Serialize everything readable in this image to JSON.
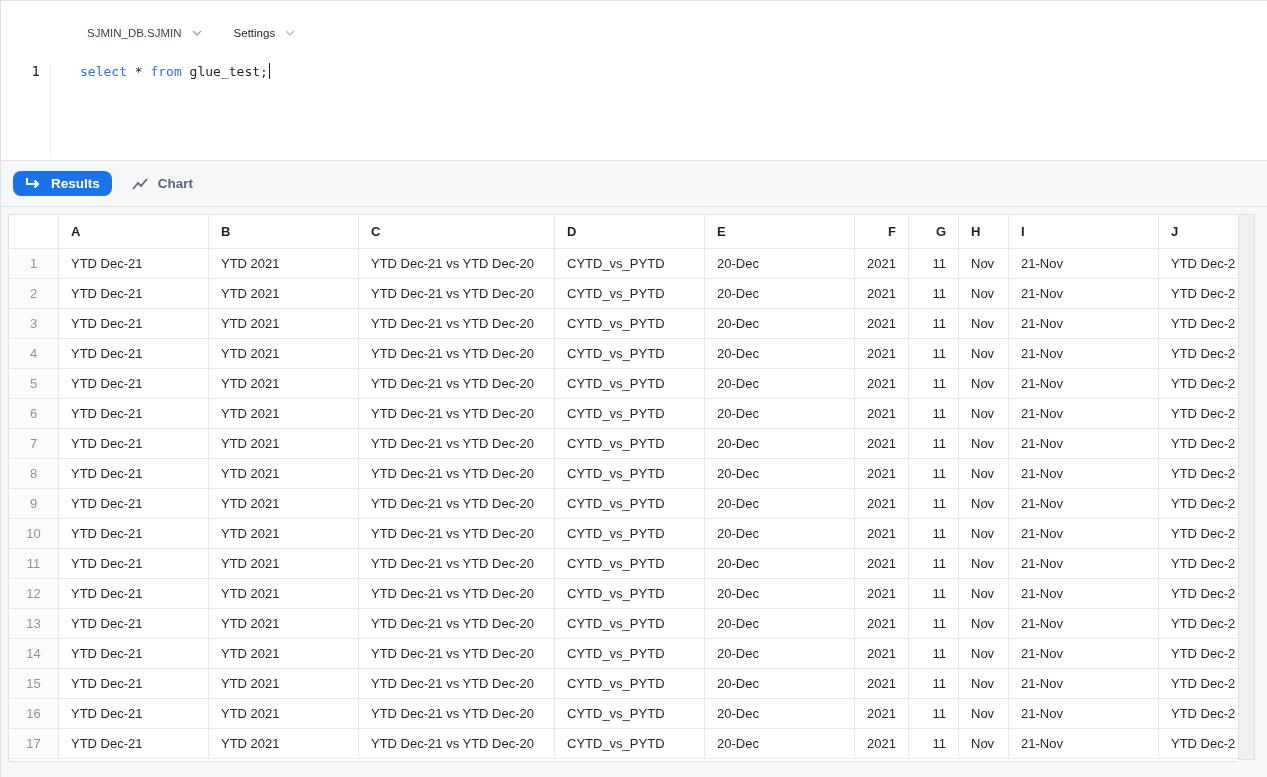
{
  "editor": {
    "context": "SJMIN_DB.SJMIN",
    "settings": "Settings",
    "lines": [
      {
        "number": "1",
        "tokens": [
          {
            "kind": "keyword",
            "text": "select"
          },
          {
            "kind": "plain",
            "text": " * "
          },
          {
            "kind": "keyword",
            "text": "from"
          },
          {
            "kind": "plain",
            "text": " glue_test;"
          }
        ]
      }
    ]
  },
  "tabs": [
    {
      "label": "Results",
      "kind": "results",
      "selected": true
    },
    {
      "label": "Chart",
      "kind": "chart",
      "selected": false
    }
  ],
  "table": {
    "columns": [
      {
        "label": "A",
        "kind": "text"
      },
      {
        "label": "B",
        "kind": "text"
      },
      {
        "label": "C",
        "kind": "text"
      },
      {
        "label": "D",
        "kind": "text"
      },
      {
        "label": "E",
        "kind": "text"
      },
      {
        "label": "F",
        "kind": "number"
      },
      {
        "label": "G",
        "kind": "number"
      },
      {
        "label": "H",
        "kind": "text"
      },
      {
        "label": "I",
        "kind": "text"
      },
      {
        "label": "J",
        "kind": "text"
      }
    ],
    "rows": [
      {
        "number": "1",
        "cells": [
          "YTD Dec-21",
          "YTD 2021",
          "YTD Dec-21 vs YTD Dec-20",
          "CYTD_vs_PYTD",
          "20-Dec",
          "2021",
          "11",
          "Nov",
          "21-Nov",
          "YTD Dec-2"
        ]
      },
      {
        "number": "2",
        "cells": [
          "YTD Dec-21",
          "YTD 2021",
          "YTD Dec-21 vs YTD Dec-20",
          "CYTD_vs_PYTD",
          "20-Dec",
          "2021",
          "11",
          "Nov",
          "21-Nov",
          "YTD Dec-2"
        ]
      },
      {
        "number": "3",
        "cells": [
          "YTD Dec-21",
          "YTD 2021",
          "YTD Dec-21 vs YTD Dec-20",
          "CYTD_vs_PYTD",
          "20-Dec",
          "2021",
          "11",
          "Nov",
          "21-Nov",
          "YTD Dec-2"
        ]
      },
      {
        "number": "4",
        "cells": [
          "YTD Dec-21",
          "YTD 2021",
          "YTD Dec-21 vs YTD Dec-20",
          "CYTD_vs_PYTD",
          "20-Dec",
          "2021",
          "11",
          "Nov",
          "21-Nov",
          "YTD Dec-2"
        ]
      },
      {
        "number": "5",
        "cells": [
          "YTD Dec-21",
          "YTD 2021",
          "YTD Dec-21 vs YTD Dec-20",
          "CYTD_vs_PYTD",
          "20-Dec",
          "2021",
          "11",
          "Nov",
          "21-Nov",
          "YTD Dec-2"
        ]
      },
      {
        "number": "6",
        "cells": [
          "YTD Dec-21",
          "YTD 2021",
          "YTD Dec-21 vs YTD Dec-20",
          "CYTD_vs_PYTD",
          "20-Dec",
          "2021",
          "11",
          "Nov",
          "21-Nov",
          "YTD Dec-2"
        ]
      },
      {
        "number": "7",
        "cells": [
          "YTD Dec-21",
          "YTD 2021",
          "YTD Dec-21 vs YTD Dec-20",
          "CYTD_vs_PYTD",
          "20-Dec",
          "2021",
          "11",
          "Nov",
          "21-Nov",
          "YTD Dec-2"
        ]
      },
      {
        "number": "8",
        "cells": [
          "YTD Dec-21",
          "YTD 2021",
          "YTD Dec-21 vs YTD Dec-20",
          "CYTD_vs_PYTD",
          "20-Dec",
          "2021",
          "11",
          "Nov",
          "21-Nov",
          "YTD Dec-2"
        ]
      },
      {
        "number": "9",
        "cells": [
          "YTD Dec-21",
          "YTD 2021",
          "YTD Dec-21 vs YTD Dec-20",
          "CYTD_vs_PYTD",
          "20-Dec",
          "2021",
          "11",
          "Nov",
          "21-Nov",
          "YTD Dec-2"
        ]
      },
      {
        "number": "10",
        "cells": [
          "YTD Dec-21",
          "YTD 2021",
          "YTD Dec-21 vs YTD Dec-20",
          "CYTD_vs_PYTD",
          "20-Dec",
          "2021",
          "11",
          "Nov",
          "21-Nov",
          "YTD Dec-2"
        ]
      },
      {
        "number": "11",
        "cells": [
          "YTD Dec-21",
          "YTD 2021",
          "YTD Dec-21 vs YTD Dec-20",
          "CYTD_vs_PYTD",
          "20-Dec",
          "2021",
          "11",
          "Nov",
          "21-Nov",
          "YTD Dec-2"
        ]
      },
      {
        "number": "12",
        "cells": [
          "YTD Dec-21",
          "YTD 2021",
          "YTD Dec-21 vs YTD Dec-20",
          "CYTD_vs_PYTD",
          "20-Dec",
          "2021",
          "11",
          "Nov",
          "21-Nov",
          "YTD Dec-2"
        ]
      },
      {
        "number": "13",
        "cells": [
          "YTD Dec-21",
          "YTD 2021",
          "YTD Dec-21 vs YTD Dec-20",
          "CYTD_vs_PYTD",
          "20-Dec",
          "2021",
          "11",
          "Nov",
          "21-Nov",
          "YTD Dec-2"
        ]
      },
      {
        "number": "14",
        "cells": [
          "YTD Dec-21",
          "YTD 2021",
          "YTD Dec-21 vs YTD Dec-20",
          "CYTD_vs_PYTD",
          "20-Dec",
          "2021",
          "11",
          "Nov",
          "21-Nov",
          "YTD Dec-2"
        ]
      },
      {
        "number": "15",
        "cells": [
          "YTD Dec-21",
          "YTD 2021",
          "YTD Dec-21 vs YTD Dec-20",
          "CYTD_vs_PYTD",
          "20-Dec",
          "2021",
          "11",
          "Nov",
          "21-Nov",
          "YTD Dec-2"
        ]
      },
      {
        "number": "16",
        "cells": [
          "YTD Dec-21",
          "YTD 2021",
          "YTD Dec-21 vs YTD Dec-20",
          "CYTD_vs_PYTD",
          "20-Dec",
          "2021",
          "11",
          "Nov",
          "21-Nov",
          "YTD Dec-2"
        ]
      },
      {
        "number": "17",
        "cells": [
          "YTD Dec-21",
          "YTD 2021",
          "YTD Dec-21 vs YTD Dec-20",
          "CYTD_vs_PYTD",
          "20-Dec",
          "2021",
          "11",
          "Nov",
          "21-Nov",
          "YTD Dec-2"
        ]
      }
    ]
  }
}
